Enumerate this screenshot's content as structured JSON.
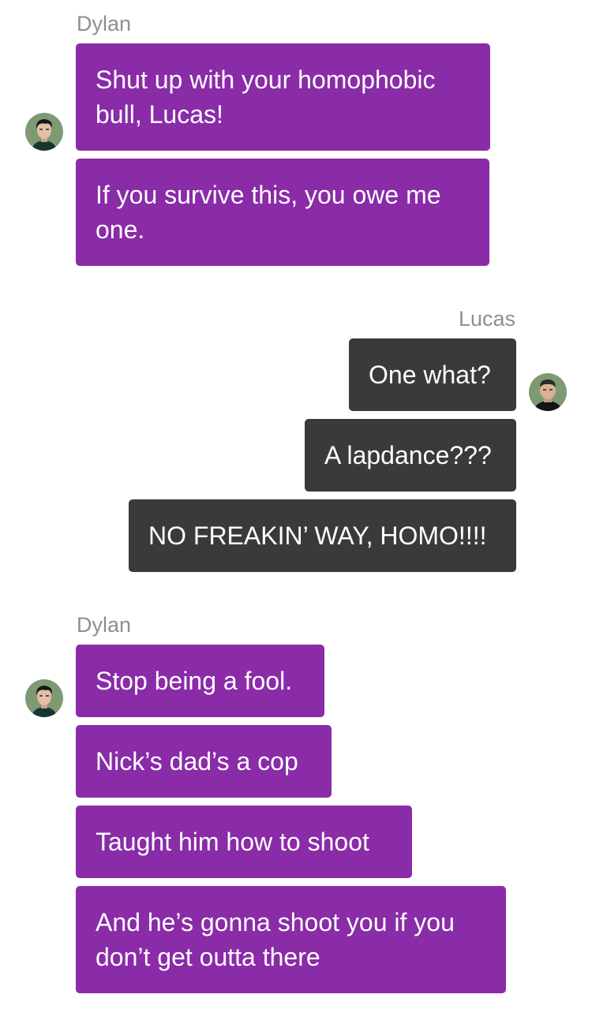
{
  "groups": [
    {
      "sender": "Dylan",
      "side": "left",
      "avatar_icon": "dylan-avatar-icon",
      "messages": [
        "Shut up with your homophobic bull, Lucas!",
        "If you survive this, you owe me one."
      ]
    },
    {
      "sender": "Lucas",
      "side": "right",
      "avatar_icon": "lucas-avatar-icon",
      "messages": [
        "One what?",
        "A lapdance???",
        "NO FREAKIN’ WAY, HOMO!!!!"
      ]
    },
    {
      "sender": "Dylan",
      "side": "left",
      "avatar_icon": "dylan-avatar-icon",
      "messages": [
        "Stop being a fool.",
        "Nick’s dad’s a cop",
        "Taught him how to shoot",
        "And he’s gonna shoot you if you don’t get outta there"
      ]
    }
  ],
  "colors": {
    "dylan_bubble": "#8a2ba8",
    "lucas_bubble": "#3a3a3a",
    "bubble_text": "#ffffff",
    "sender_name": "#8e8e93",
    "background": "#ffffff"
  }
}
